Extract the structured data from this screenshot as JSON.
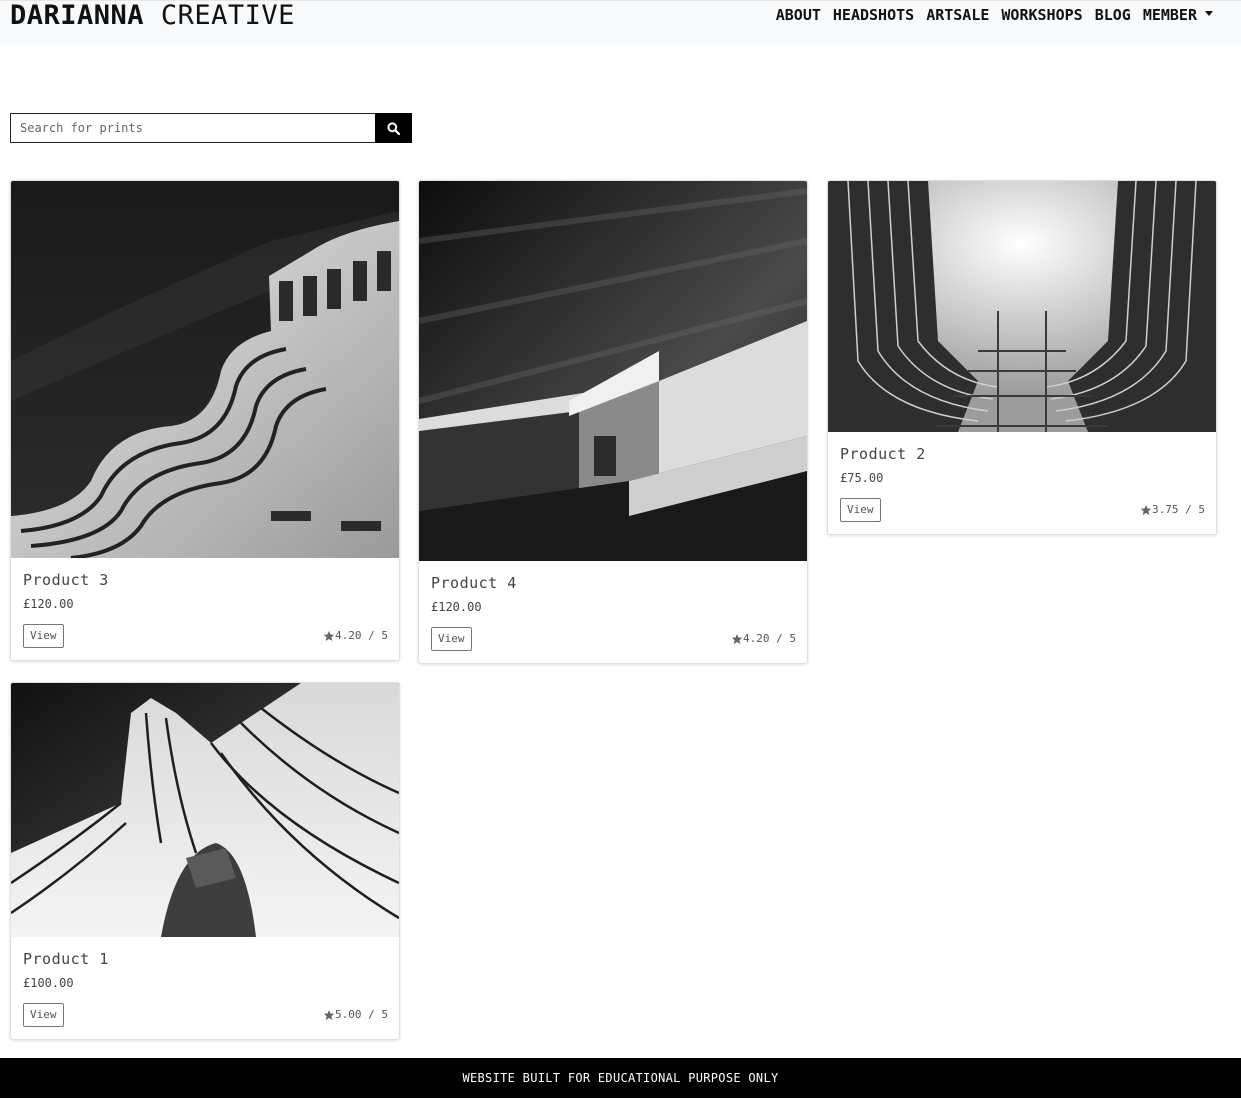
{
  "brand": {
    "bold": "DARIANNA",
    "light": "CREATIVE"
  },
  "nav": {
    "items": [
      "ABOUT",
      "HEADSHOTS",
      "ARTSALE",
      "WORKSHOPS",
      "BLOG",
      "MEMBER"
    ]
  },
  "search": {
    "placeholder": "Search for prints",
    "value": "",
    "button_icon": "search-icon"
  },
  "products": [
    {
      "title": "Product 3",
      "price": "£120.00",
      "view_label": "View",
      "rating": "4.20 / 5"
    },
    {
      "title": "Product 4",
      "price": "£120.00",
      "view_label": "View",
      "rating": "4.20 / 5"
    },
    {
      "title": "Product 2",
      "price": "£75.00",
      "view_label": "View",
      "rating": "3.75 / 5"
    },
    {
      "title": "Product 1",
      "price": "£100.00",
      "view_label": "View",
      "rating": "5.00 / 5"
    }
  ],
  "footer": {
    "text": "WEBSITE BUILT FOR EDUCATIONAL PURPOSE ONLY"
  },
  "colors": {
    "navbar_bg": "#f8f9fa",
    "footer_bg": "#000000",
    "accent": "#000000"
  }
}
